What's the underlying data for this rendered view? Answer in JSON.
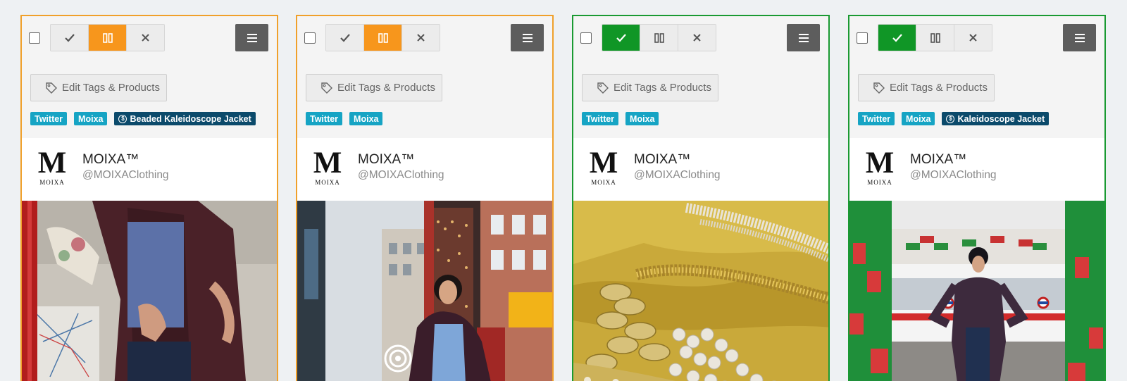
{
  "cards": [
    {
      "status": "pending",
      "edit_label": "Edit Tags & Products",
      "tags": [
        "Twitter",
        "Moixa"
      ],
      "product": "Beaded Kaleidoscope Jacket",
      "author_name": "MOIXA™",
      "author_handle": "@MOIXAClothing",
      "logo_letter": "M",
      "logo_word": "MOIXA"
    },
    {
      "status": "pending",
      "edit_label": "Edit Tags & Products",
      "tags": [
        "Twitter",
        "Moixa"
      ],
      "author_name": "MOIXA™",
      "author_handle": "@MOIXAClothing",
      "logo_letter": "M",
      "logo_word": "MOIXA"
    },
    {
      "status": "approved",
      "edit_label": "Edit Tags & Products",
      "tags": [
        "Twitter",
        "Moixa"
      ],
      "author_name": "MOIXA™",
      "author_handle": "@MOIXAClothing",
      "logo_letter": "M",
      "logo_word": "MOIXA"
    },
    {
      "status": "approved",
      "edit_label": "Edit Tags & Products",
      "tags": [
        "Twitter",
        "Moixa"
      ],
      "product": "Kaleidoscope Jacket",
      "author_name": "MOIXA™",
      "author_handle": "@MOIXAClothing",
      "logo_letter": "M",
      "logo_word": "MOIXA"
    }
  ],
  "colors": {
    "pending_border": "#f0a02a",
    "approved_border": "#1a9a32",
    "pending_active": "#f7961c",
    "approved_active": "#109626",
    "social_tag": "#16a4c4",
    "product_tag": "#0b4a6b"
  },
  "icons": {
    "approve": "check-icon",
    "pending": "pause-columns-icon",
    "reject": "close-icon",
    "menu": "hamburger-menu-icon",
    "edit": "tag-icon",
    "product": "dollar-circle-icon"
  }
}
